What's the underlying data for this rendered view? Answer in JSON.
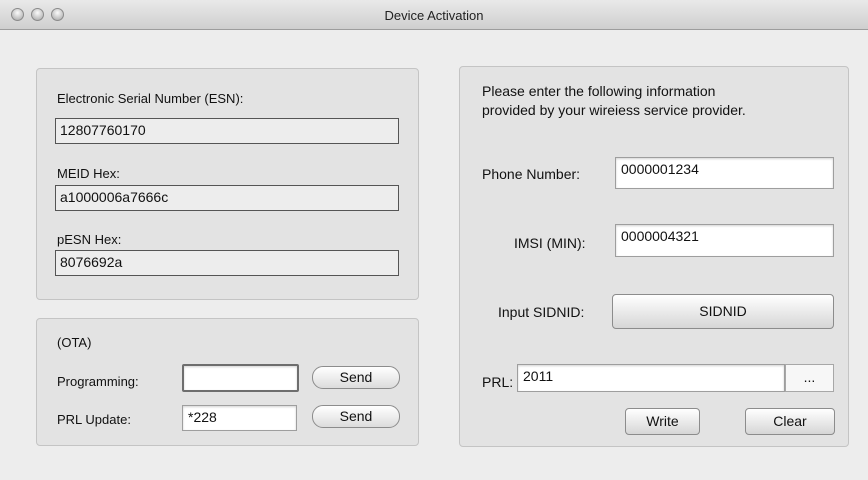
{
  "window": {
    "title": "Device Activation"
  },
  "identity": {
    "esn_label": "Electronic Serial Number (ESN):",
    "esn_value": "12807760170",
    "meid_label": "MEID Hex:",
    "meid_value": "a1000006a7666c",
    "pesn_label": "pESN Hex:",
    "pesn_value": "8076692a"
  },
  "ota": {
    "title": "(OTA)",
    "programming_label": "Programming:",
    "programming_value": "",
    "prl_update_label": "PRL Update:",
    "prl_update_value": "*228",
    "send_label": "Send"
  },
  "provider": {
    "instructions_line1": "Please enter the following information",
    "instructions_line2": "provided by your wireiess service provider.",
    "phone_label": "Phone Number:",
    "phone_value": "0000001234",
    "imsi_label": "IMSI (MIN):",
    "imsi_value": "0000004321",
    "sidnid_label": "Input SIDNID:",
    "sidnid_button": "SIDNID",
    "prl_label": "PRL:",
    "prl_value": "2011",
    "browse_label": "...",
    "write_label": "Write",
    "clear_label": "Clear"
  }
}
